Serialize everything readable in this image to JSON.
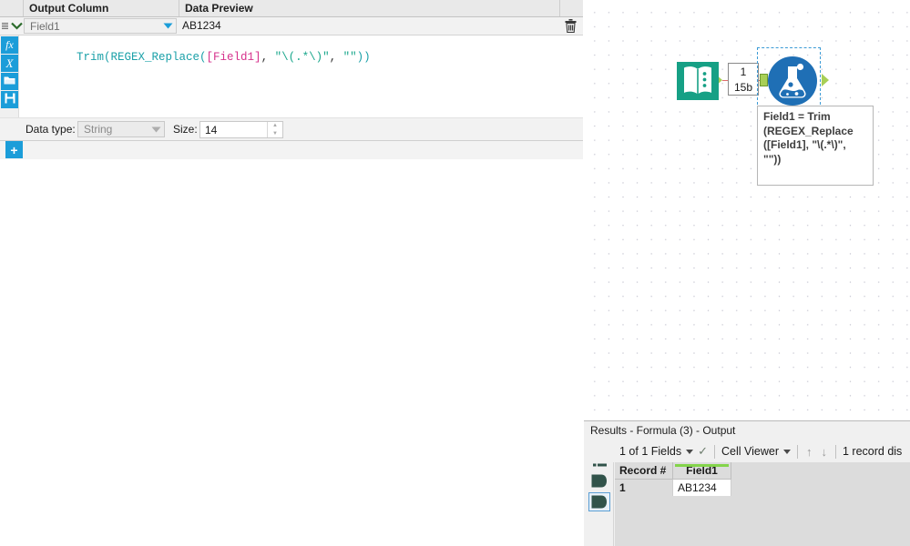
{
  "config_panel": {
    "columns": {
      "output_column": "Output Column",
      "data_preview": "Data Preview"
    },
    "row": {
      "output_field": "Field1",
      "data_preview_value": "AB1234",
      "delete_icon": "trash-icon",
      "grip_icon": "drag-grip-icon",
      "expand_icon": "chevron-down-icon"
    },
    "vertical_toolbar": [
      {
        "name": "functions-button",
        "glyph": "fx"
      },
      {
        "name": "variables-button",
        "glyph": "X"
      },
      {
        "name": "open-expression-button",
        "glyph": "folder-icon"
      },
      {
        "name": "save-expression-button",
        "glyph": "save-icon"
      }
    ],
    "formula": {
      "full_text": "Trim(REGEX_Replace([Field1], \"\\(.*\\)\", \"\"))",
      "tokens": [
        {
          "t": "Trim(REGEX_Replace(",
          "c": "fn"
        },
        {
          "t": "[Field1]",
          "c": "fld"
        },
        {
          "t": ", ",
          "c": "pln"
        },
        {
          "t": "\"\\(.*\\)\"",
          "c": "str"
        },
        {
          "t": ", ",
          "c": "pln"
        },
        {
          "t": "\"\"",
          "c": "str"
        },
        {
          "t": "))",
          "c": "fn"
        }
      ]
    },
    "data_type_label": "Data type:",
    "data_type_value": "String",
    "size_label": "Size:",
    "size_value": "14",
    "add_button_glyph": "+"
  },
  "canvas": {
    "nodes": [
      {
        "name": "text-input-tool",
        "icon": "book-icon",
        "color": "#16a085"
      },
      {
        "name": "formula-tool",
        "icon": "flask-icon",
        "color": "#1f6fb5"
      }
    ],
    "connection_label": {
      "records": "1",
      "size": "15b"
    },
    "annotation": "Field1 = Trim\n(REGEX_Replace\n([Field1], \"\\(.*\\)\",\n\"\"))"
  },
  "results": {
    "title": "Results - Formula (3) - Output",
    "toolbar": {
      "fields": "1 of 1 Fields",
      "viewer": "Cell Viewer",
      "up_arrow": "↑",
      "down_arrow": "↓",
      "record_count": "1 record dis"
    },
    "grid": {
      "headers": [
        "Record #",
        "Field1"
      ],
      "rows": [
        [
          "1",
          "AB1234"
        ]
      ]
    },
    "side_icons": [
      {
        "name": "list-view-icon"
      },
      {
        "name": "input-anchor-icon"
      },
      {
        "name": "output-anchor-icon"
      }
    ]
  }
}
